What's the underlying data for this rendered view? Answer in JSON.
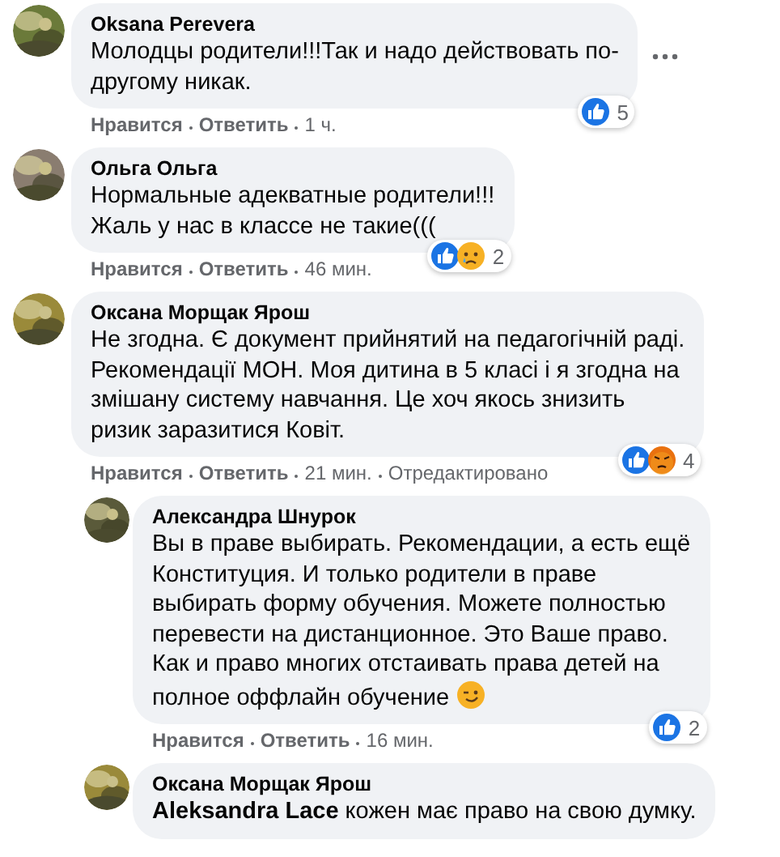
{
  "comments": [
    {
      "author": "Oksana Perevera",
      "reply": false,
      "text": "Молодцы родители!!!Так и надо действовать по-\nдругому никак.",
      "more_menu": true,
      "reactions": {
        "icons": [
          {
            "kind": "like"
          }
        ],
        "count": "5"
      },
      "actions": [
        "Нравится",
        "Ответить"
      ],
      "time": "1 ч."
    },
    {
      "author": "Ольга Ольга",
      "reply": false,
      "text": "Нормальные адекватные родители!!!\nЖаль у нас в классе не такие(((",
      "more_menu": false,
      "reactions": {
        "icons": [
          {
            "kind": "like"
          },
          {
            "kind": "sad"
          }
        ],
        "count": "2"
      },
      "actions": [
        "Нравится",
        "Ответить"
      ],
      "time": "46 мин."
    },
    {
      "author": "Оксана Морщак Ярош",
      "reply": false,
      "text": "Не згодна. Є документ прийнятий на педагогічній раді.\nРекомендації МОН. Моя дитина в 5 класі і я згодна на\nзмішану систему навчання. Це хоч якось знизить\nризик заразитися Ковіт.",
      "more_menu": false,
      "reactions": {
        "icons": [
          {
            "kind": "like"
          },
          {
            "kind": "angry"
          }
        ],
        "count": "4"
      },
      "actions": [
        "Нравится",
        "Ответить"
      ],
      "time": "21 мин.",
      "edited": "Отредактировано"
    },
    {
      "author": "Александра Шнурок",
      "reply": true,
      "text": "Вы в праве выбирать. Рекомендации, а есть ещё\nКонституция. И только родители в праве\nвыбирать форму обучения. Можете полностью\nперевести на дистанционное. Это Ваше право.\nКак и право многих отстаивать права детей на\nполное оффлайн обучение",
      "emojis": [
        {
          "kind": "wink"
        }
      ],
      "more_menu": false,
      "reactions": {
        "icons": [
          {
            "kind": "like"
          }
        ],
        "count": "2"
      },
      "actions": [
        "Нравится",
        "Ответить"
      ],
      "time": "16 мин."
    },
    {
      "author": "Оксана Морщак Ярош",
      "reply": true,
      "text": "**Aleksandra Lace** кожен має право на свою думку.",
      "more_menu": false
    }
  ]
}
